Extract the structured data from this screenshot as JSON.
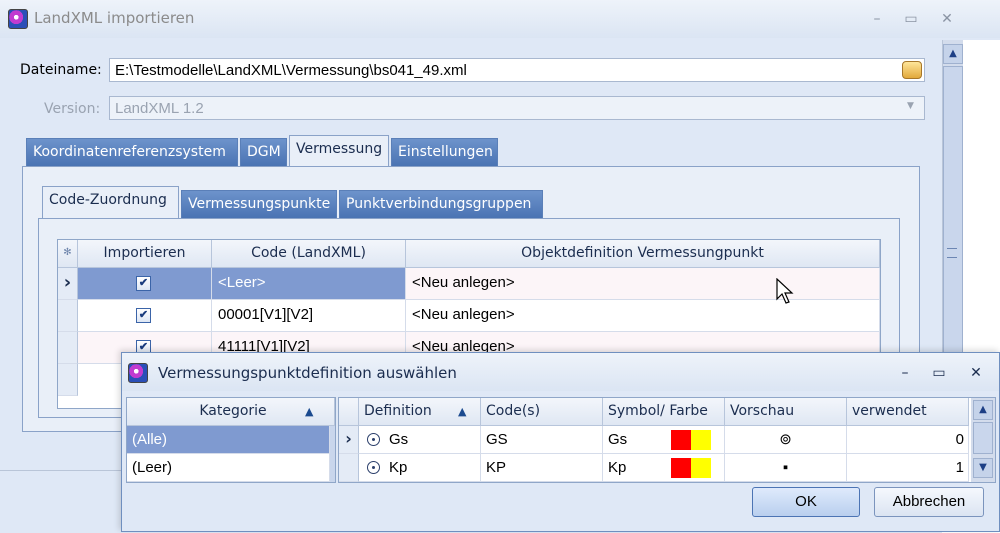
{
  "window": {
    "title": "LandXML importieren",
    "buttons": {
      "minimize": "–",
      "maximize": "▭",
      "close": "✕"
    }
  },
  "form": {
    "filename_label": "Dateiname:",
    "filename_value": "E:\\Testmodelle\\LandXML\\Vermessung\\bs041_49.xml",
    "version_label": "Version:",
    "version_value": "LandXML 1.2"
  },
  "tabs": [
    "Koordinatenreferenzsystem",
    "DGM",
    "Vermessung",
    "Einstellungen"
  ],
  "active_tab": "Vermessung",
  "subtabs": [
    "Code-Zuordnung",
    "Vermessungspunkte",
    "Punktverbindungsgruppen"
  ],
  "active_subtab": "Code-Zuordnung",
  "grid": {
    "corner_glyph": "✻",
    "columns": [
      "Importieren",
      "Code (LandXML)",
      "Objektdefinition Vermessungpunkt"
    ],
    "rows": [
      {
        "indicator": "›",
        "import": "✔",
        "code": "<Leer>",
        "objdef": "<Neu anlegen>"
      },
      {
        "indicator": "",
        "import": "✔",
        "code": "00001[V1][V2]",
        "objdef": "<Neu anlegen>"
      },
      {
        "indicator": "",
        "import": "✔",
        "code": "41111[V1][V2]",
        "objdef": "<Neu anlegen>"
      }
    ]
  },
  "popup": {
    "title": "Vermessungspunktdefinition auswählen",
    "buttons": {
      "minimize": "–",
      "maximize": "▭",
      "close": "✕"
    },
    "category_header": "Kategorie",
    "sort_arrow": "▲",
    "categories": [
      "(Alle)",
      "(Leer)"
    ],
    "columns": [
      "Definition",
      "Code(s)",
      "Symbol/ Farbe",
      "Vorschau",
      "verwendet"
    ],
    "rows": [
      {
        "indicator": "›",
        "definition": "Gs",
        "codes": "GS",
        "symbol": "Gs",
        "colors": [
          "#ff0000",
          "#ffff00"
        ],
        "preview": "⊚",
        "used": "0"
      },
      {
        "indicator": "",
        "definition": "Kp",
        "codes": "KP",
        "symbol": "Kp",
        "colors": [
          "#ff0000",
          "#ffff00"
        ],
        "preview": "▪",
        "used": "1"
      }
    ],
    "ok_label": "OK",
    "cancel_label": "Abbrechen"
  },
  "colors": {
    "accent": "#4a73b3",
    "selection": "#7f9ad0",
    "window_bg": "#dfe8f6"
  }
}
